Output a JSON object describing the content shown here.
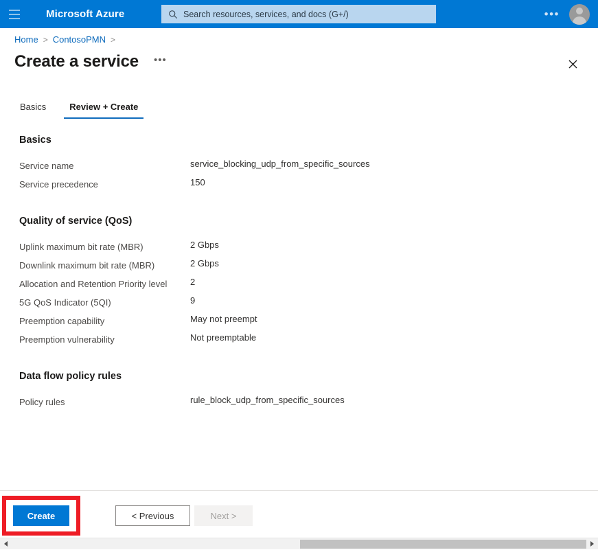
{
  "header": {
    "menu_icon": "hamburger-icon",
    "brand": "Microsoft Azure",
    "search": {
      "icon": "search-icon",
      "placeholder": "Search resources, services, and docs (G+/)",
      "value": ""
    },
    "more_label": "•••",
    "account_icon": "user-avatar-icon",
    "accent_color": "#0078d4",
    "search_bg_color": "#b9d6ef"
  },
  "breadcrumb": {
    "items": [
      {
        "label": "Home"
      },
      {
        "label": "ContosoPMN"
      }
    ],
    "separator": ">"
  },
  "page": {
    "title": "Create a service",
    "more_label": "•••",
    "close_icon": "close-icon"
  },
  "tabs": [
    {
      "label": "Basics",
      "active": false
    },
    {
      "label": "Review + Create",
      "active": true
    }
  ],
  "sections": [
    {
      "key": "basics",
      "title": "Basics",
      "rows": [
        {
          "label": "Service name",
          "value": "service_blocking_udp_from_specific_sources"
        },
        {
          "label": "Service precedence",
          "value": "150"
        }
      ]
    },
    {
      "key": "qos",
      "title": "Quality of service (QoS)",
      "rows": [
        {
          "label": "Uplink maximum bit rate (MBR)",
          "value": "2 Gbps"
        },
        {
          "label": "Downlink maximum bit rate (MBR)",
          "value": "2 Gbps"
        },
        {
          "label": "Allocation and Retention Priority level",
          "value": "2"
        },
        {
          "label": "5G QoS Indicator (5QI)",
          "value": "9"
        },
        {
          "label": "Preemption capability",
          "value": "May not preempt"
        },
        {
          "label": "Preemption vulnerability",
          "value": "Not preemptable"
        }
      ]
    },
    {
      "key": "policy",
      "title": "Data flow policy rules",
      "rows": [
        {
          "label": "Policy rules",
          "value": "rule_block_udp_from_specific_sources"
        }
      ]
    }
  ],
  "footer": {
    "create_label": "Create",
    "previous_label": "< Previous",
    "next_label": "Next >",
    "next_disabled": true,
    "highlight_color": "#ee1c25",
    "primary_button_color": "#0078d4"
  },
  "scrollbar": {
    "left_arrow": "scroll-left-arrow",
    "right_arrow": "scroll-right-arrow"
  }
}
